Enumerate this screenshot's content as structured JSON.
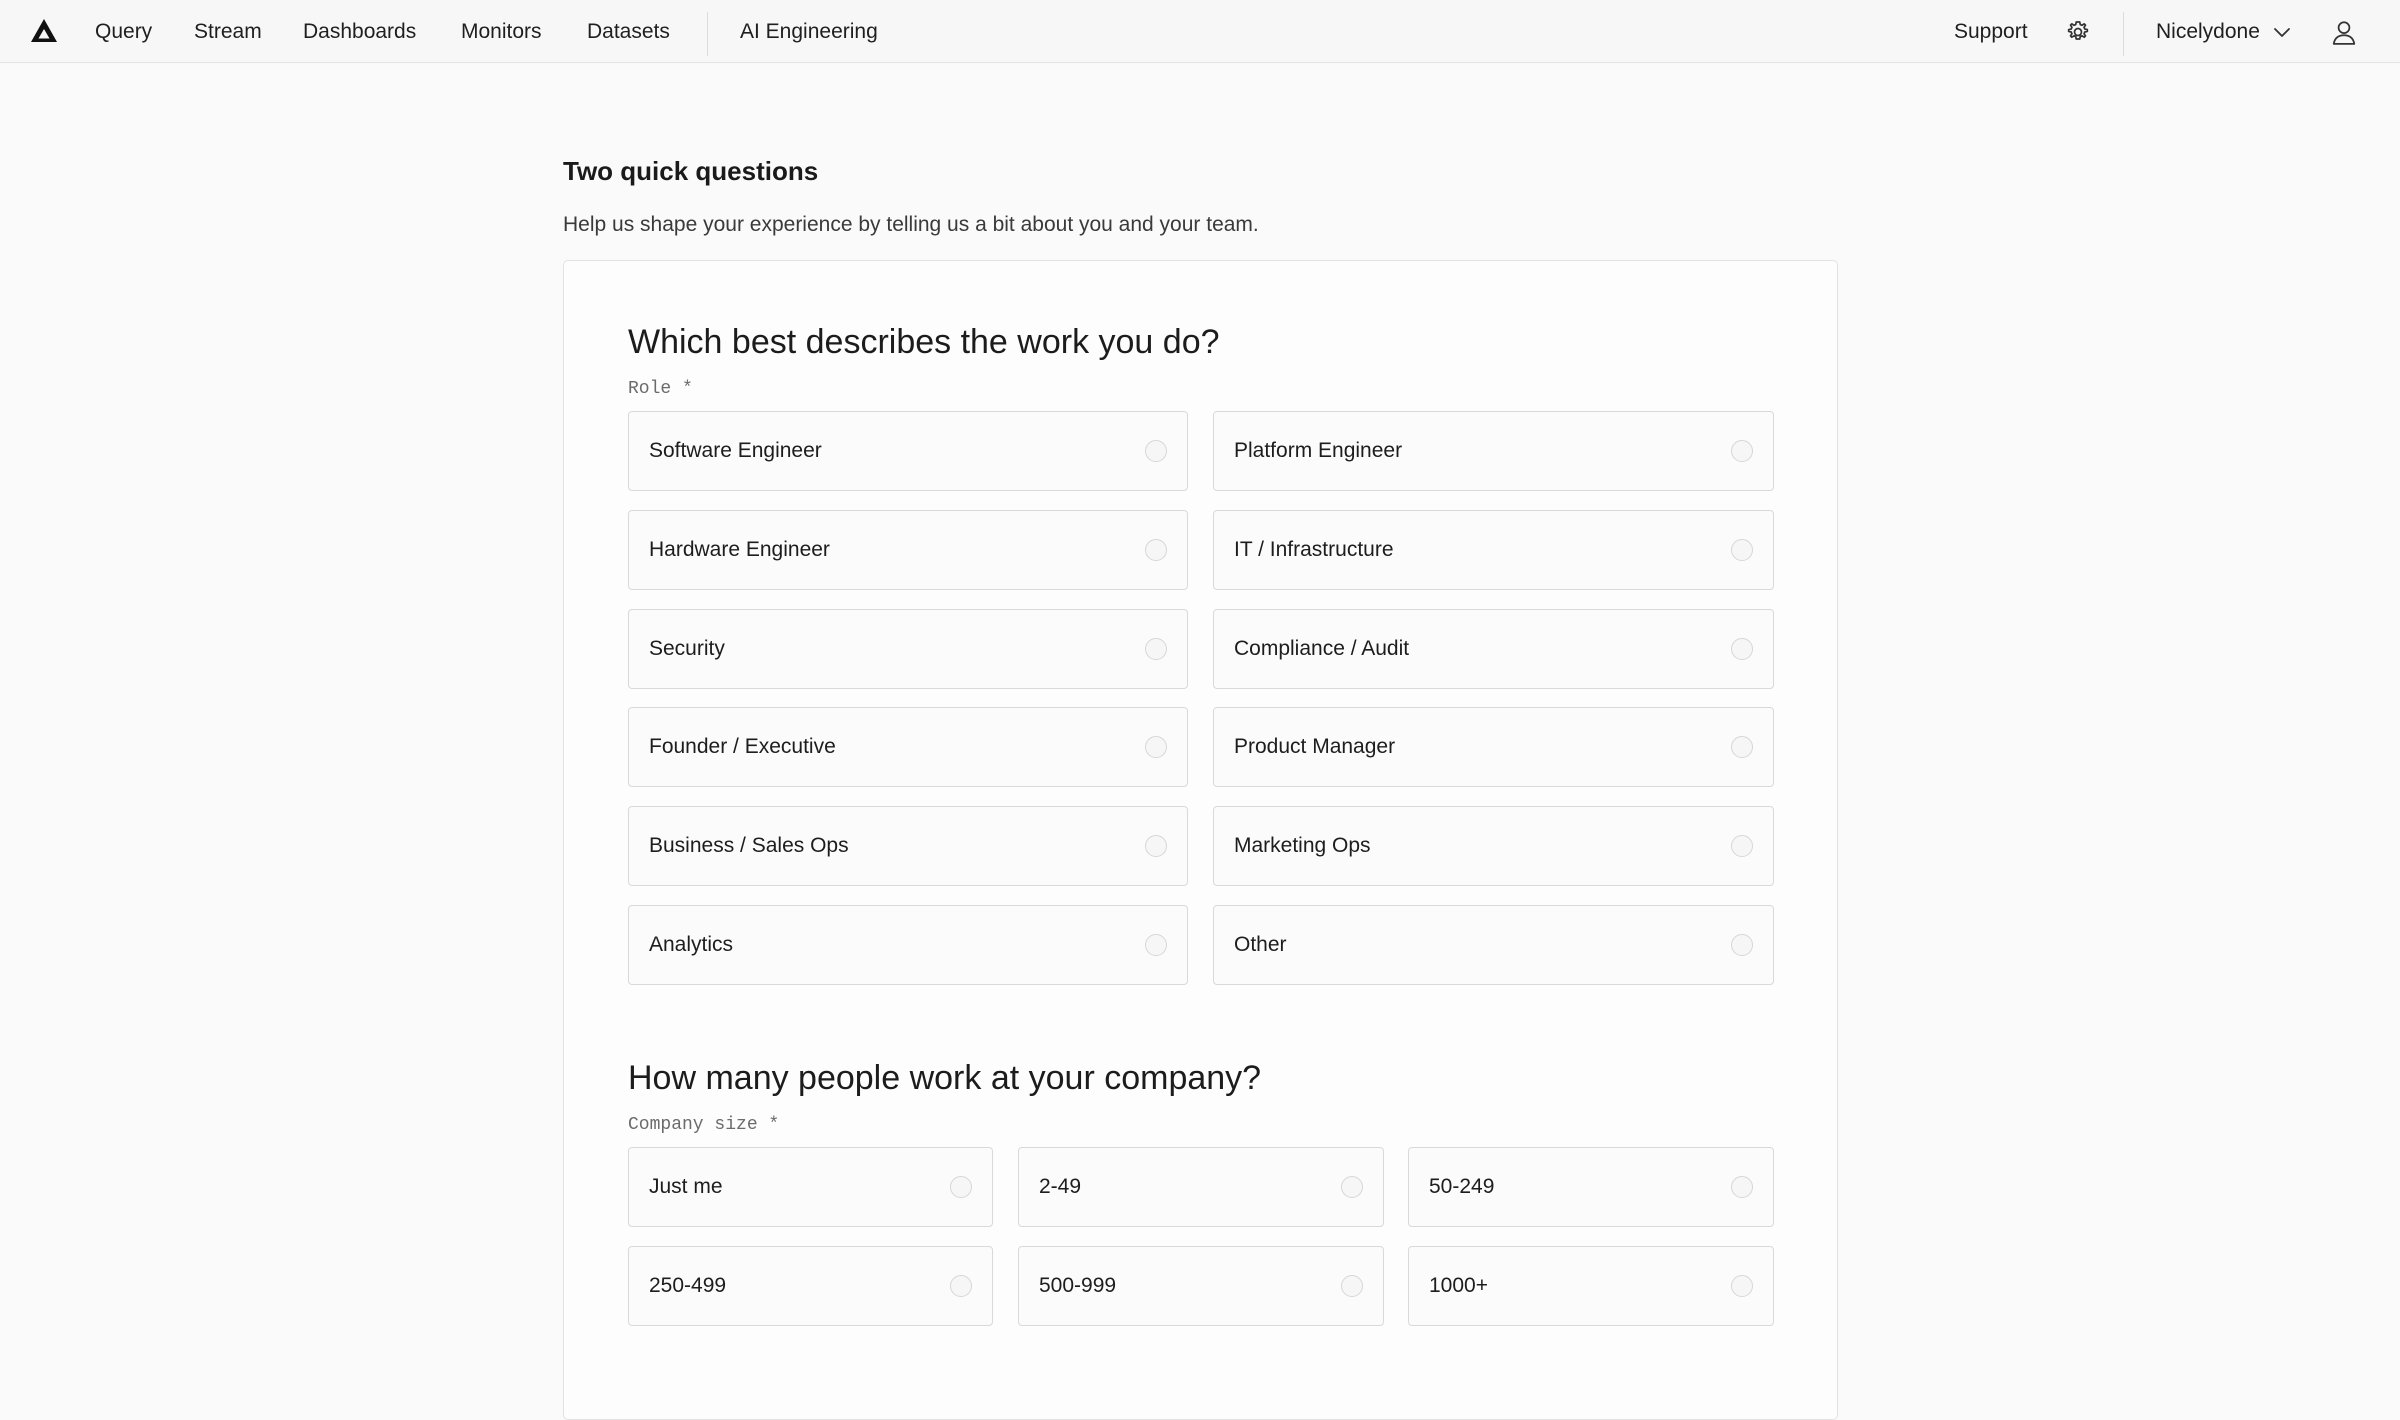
{
  "nav": {
    "items": [
      "Query",
      "Stream",
      "Dashboards",
      "Monitors",
      "Datasets"
    ],
    "ai_engineering": "AI Engineering",
    "support": "Support",
    "org": "Nicelydone",
    "icons": {
      "logo": "logo-icon",
      "settings": "gear-icon",
      "org_dropdown": "chevron-down-icon",
      "user": "user-icon"
    }
  },
  "page": {
    "title": "Two quick questions",
    "subtitle": "Help us shape your experience by telling us a bit about you and your team."
  },
  "role_question": {
    "title": "Which best describes the work you do?",
    "label": "Role *",
    "options": [
      "Software Engineer",
      "Platform Engineer",
      "Hardware Engineer",
      "IT / Infrastructure",
      "Security",
      "Compliance / Audit",
      "Founder / Executive",
      "Product Manager",
      "Business / Sales Ops",
      "Marketing Ops",
      "Analytics",
      "Other"
    ]
  },
  "size_question": {
    "title": "How many people work at your company?",
    "label": "Company size *",
    "options": [
      "Just me",
      "2-49",
      "50-249",
      "250-499",
      "500-999",
      "1000+"
    ]
  }
}
